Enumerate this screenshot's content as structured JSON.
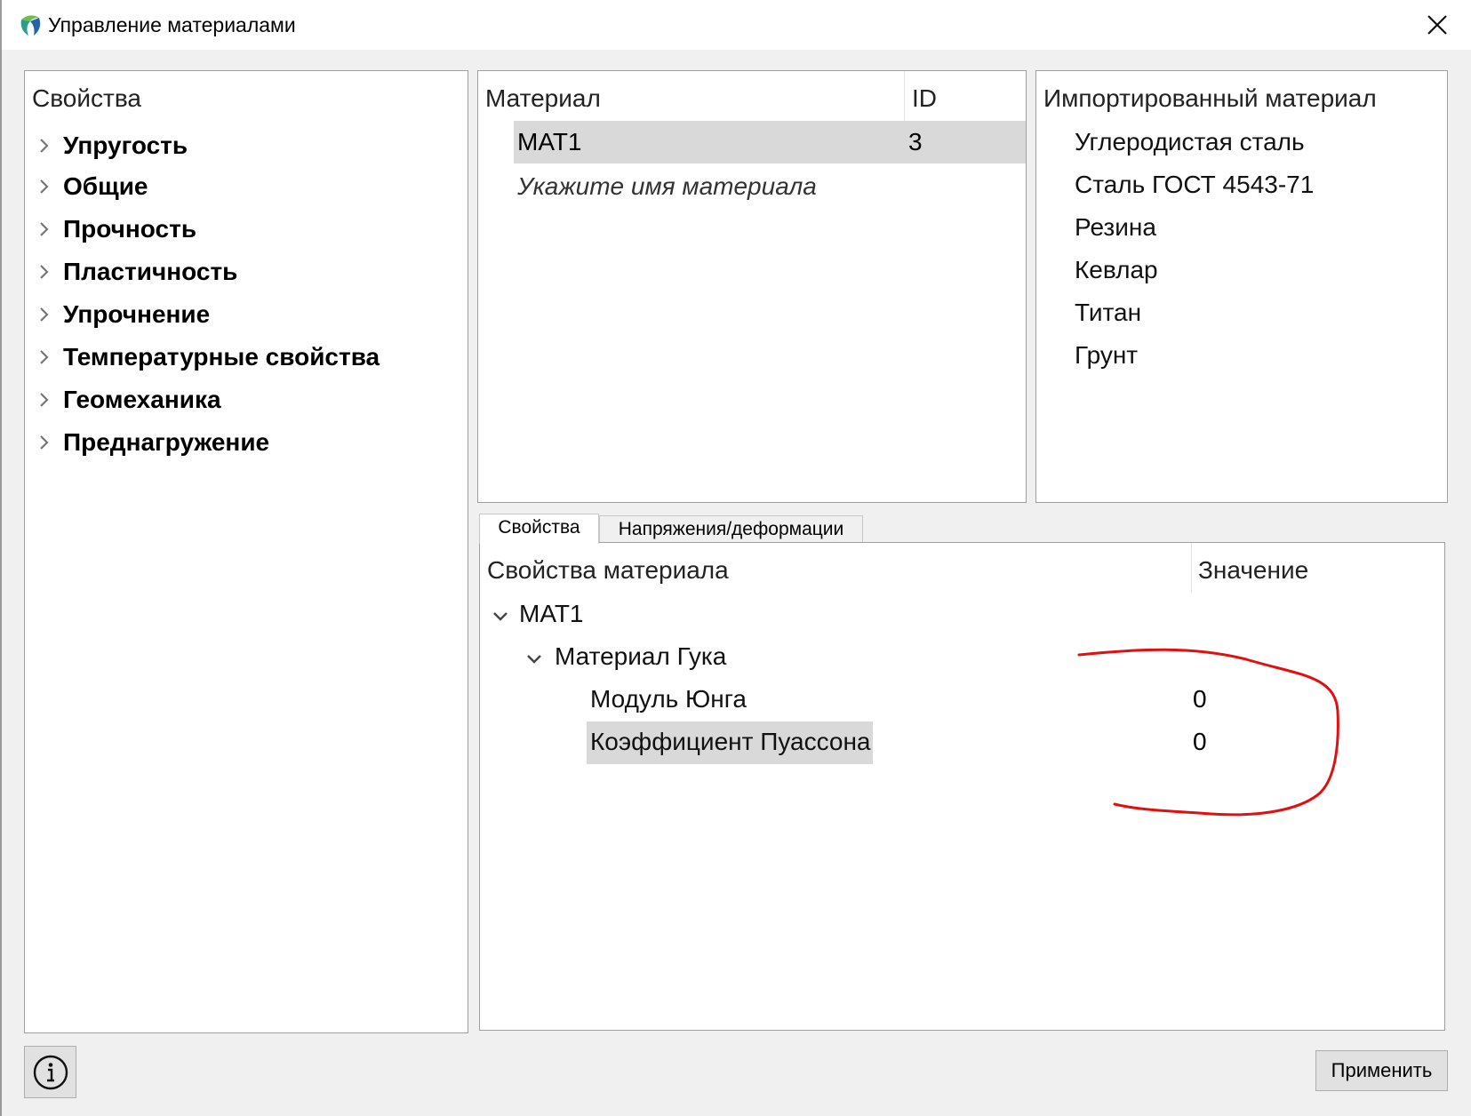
{
  "window": {
    "title": "Управление материалами"
  },
  "properties_panel": {
    "header": "Свойства",
    "items": [
      "Упругость",
      "Общие",
      "Прочность",
      "Пластичность",
      "Упрочнение",
      "Температурные свойства",
      "Геомеханика",
      "Преднагружение"
    ]
  },
  "materials_panel": {
    "col_material": "Материал",
    "col_id": "ID",
    "rows": [
      {
        "name": "МАТ1",
        "id": "3"
      }
    ],
    "placeholder": "Укажите имя материала"
  },
  "imported_panel": {
    "header": "Импортированный материал",
    "items": [
      "Углеродистая сталь",
      "Сталь ГОСТ 4543-71",
      "Резина",
      "Кевлар",
      "Титан",
      "Грунт"
    ]
  },
  "tabs": {
    "properties": "Свойства",
    "stress_strain": "Напряжения/деформации"
  },
  "material_tree": {
    "col_property": "Свойства материала",
    "col_value": "Значение",
    "root": "МАТ1",
    "group": "Материал Гука",
    "rows": [
      {
        "name": "Модуль Юнга",
        "value": "0"
      },
      {
        "name": "Коэффициент Пуассона",
        "value": "0"
      }
    ]
  },
  "buttons": {
    "apply": "Применить"
  },
  "colors": {
    "annotation": "#e01010",
    "selection": "#d9d9d9"
  }
}
